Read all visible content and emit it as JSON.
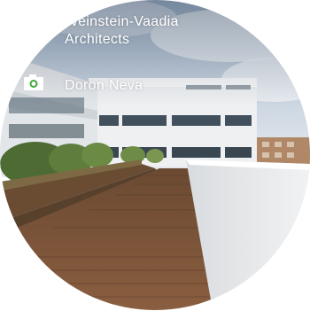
{
  "credits": {
    "architect": {
      "icon": "pencil-icon",
      "line1": "Weinstein-Vaadia",
      "line2": "Architects"
    },
    "photographer": {
      "icon": "camera-icon",
      "name": "Doron Neva"
    }
  },
  "colors": {
    "text": "#ffffff",
    "icon_pencil": "#3fa83a",
    "icon_camera": "#ffffff"
  }
}
